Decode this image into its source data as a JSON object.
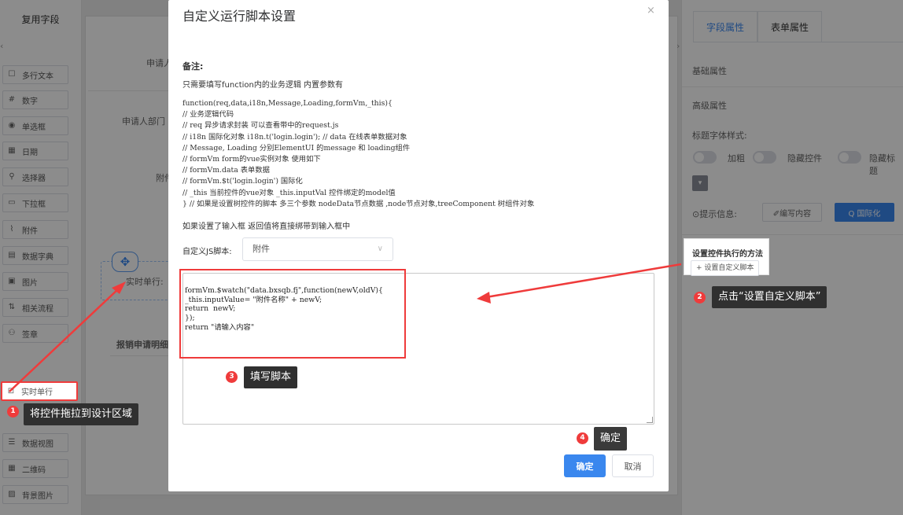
{
  "left_panel": {
    "title": "复用字段",
    "items": [
      {
        "label": "多行文本",
        "icon": "textarea-icon",
        "glyph": "☐"
      },
      {
        "label": "数字",
        "icon": "number-icon",
        "glyph": "#"
      },
      {
        "label": "单选框",
        "icon": "radio-icon",
        "glyph": "◉"
      },
      {
        "label": "日期",
        "icon": "calendar-icon",
        "glyph": "▦"
      },
      {
        "label": "选择器",
        "icon": "selector-icon",
        "glyph": "⚲"
      },
      {
        "label": "下拉框",
        "icon": "dropdown-icon",
        "glyph": "▭"
      },
      {
        "label": "附件",
        "icon": "attachment-icon",
        "glyph": "⌇"
      },
      {
        "label": "数据字典",
        "icon": "dictionary-icon",
        "glyph": "▤"
      },
      {
        "label": "图片",
        "icon": "image-icon",
        "glyph": "▣"
      },
      {
        "label": "相关流程",
        "icon": "flow-icon",
        "glyph": "⇅"
      },
      {
        "label": "签章",
        "icon": "seal-icon",
        "glyph": "⚇"
      },
      {
        "label": "实时单行",
        "icon": "realtime-input-icon",
        "glyph": "⊡"
      },
      {
        "label": "数据视图",
        "icon": "dataview-icon",
        "glyph": "☰"
      },
      {
        "label": "二维码",
        "icon": "qrcode-icon",
        "glyph": "▦"
      },
      {
        "label": "背景图片",
        "icon": "background-image-icon",
        "glyph": "▨"
      }
    ]
  },
  "canvas": {
    "labels": [
      "申请人",
      "申请人部门",
      "附件",
      "报销申请明细"
    ],
    "dropped_label": "实时单行:",
    "move_icon": "move-icon"
  },
  "right_panel": {
    "tabs": [
      "字段属性",
      "表单属性"
    ],
    "basic": "基础属性",
    "advanced": "高级属性",
    "font_style": "标题字体样式:",
    "toggle_bold": "加粗",
    "toggle_hide_control": "隐藏控件",
    "toggle_hide_title": "隐藏标题",
    "tip_label": "⊙提示信息:",
    "edit_content_btn": "✐编写内容",
    "i18n_btn": "Q 国际化",
    "method_title": "设置控件执行的方法",
    "method_button": "+ 设置自定义脚本"
  },
  "dialog": {
    "title": "自定义运行脚本设置",
    "close": "×",
    "note_head": "备注:",
    "note_sub": "只需要填写function内的业务逻辑 内置参数有",
    "code_note": "function(req,data,i18n,Message,Loading,formVm,_this){\n// 业务逻辑代码\n// req 异步请求封装 可以查看带中的request.js\n// i18n 国际化对象 i18n.t('login.login'); // data 在线表单数据对象\n// Message, Loading 分别ElementUI 的message 和 loading组件\n// formVm form的vue实例对象 使用如下\n// formVm.data 表单数据\n// formVm.$t('login.login') 国际化\n// _this 当前控件的vue对象 _this.inputVal 控件绑定的model值\n} // 如果是设置树控件的脚本 多三个参数 nodeData节点数据 ,node节点对象,treeComponent 树组件对象",
    "input_hint": "如果设置了输入框 返回值将直接绑带到输入框中",
    "js_label": "自定义JS脚本:",
    "js_select_value": "附件",
    "script": "formVm.$watch(\"data.bxsqb.fj\",function(newV,oldV){\n_this.inputValue= \"附件名称\" + newV;\nreturn  newV;\n});\nreturn \"请输入内容\"",
    "ok": "确定",
    "cancel": "取消"
  },
  "annotations": [
    {
      "num": "1",
      "text": "将控件拖拉到设计区域"
    },
    {
      "num": "2",
      "text": "点击“设置自定义脚本”"
    },
    {
      "num": "3",
      "text": "填写脚本"
    },
    {
      "num": "4",
      "text": "确定"
    }
  ],
  "colors": {
    "accent": "#3a87ee",
    "annotation_red": "#ef3b3b",
    "callout_bg": "#303030"
  }
}
